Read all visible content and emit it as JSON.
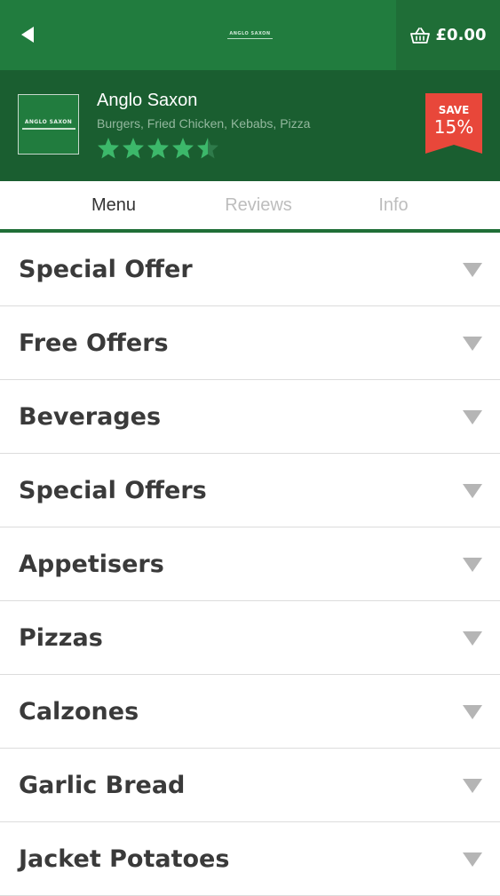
{
  "header": {
    "back_icon": "back-arrow-icon",
    "logo_text": "ANGLO SAXON",
    "basket_icon": "basket-icon",
    "basket_total": "£0.00"
  },
  "restaurant": {
    "name": "Anglo Saxon",
    "cuisines": "Burgers, Fried Chicken, Kebabs, Pizza",
    "logo_text": "ANGLO SAXON",
    "rating": 4.5,
    "rating_max": 5,
    "save_label": "SAVE",
    "save_value": "15%"
  },
  "tabs": [
    {
      "label": "Menu",
      "active": true
    },
    {
      "label": "Reviews",
      "active": false
    },
    {
      "label": "Info",
      "active": false
    }
  ],
  "menu": {
    "categories": [
      "Special Offer",
      "Free Offers",
      "Beverages",
      "Special Offers",
      "Appetisers",
      "Pizzas",
      "Calzones",
      "Garlic Bread",
      "Jacket Potatoes"
    ]
  },
  "colors": {
    "header_green": "#217c3e",
    "restaurant_green": "#1a5e30",
    "star_green": "#3cb86a",
    "save_red": "#e8473a"
  }
}
